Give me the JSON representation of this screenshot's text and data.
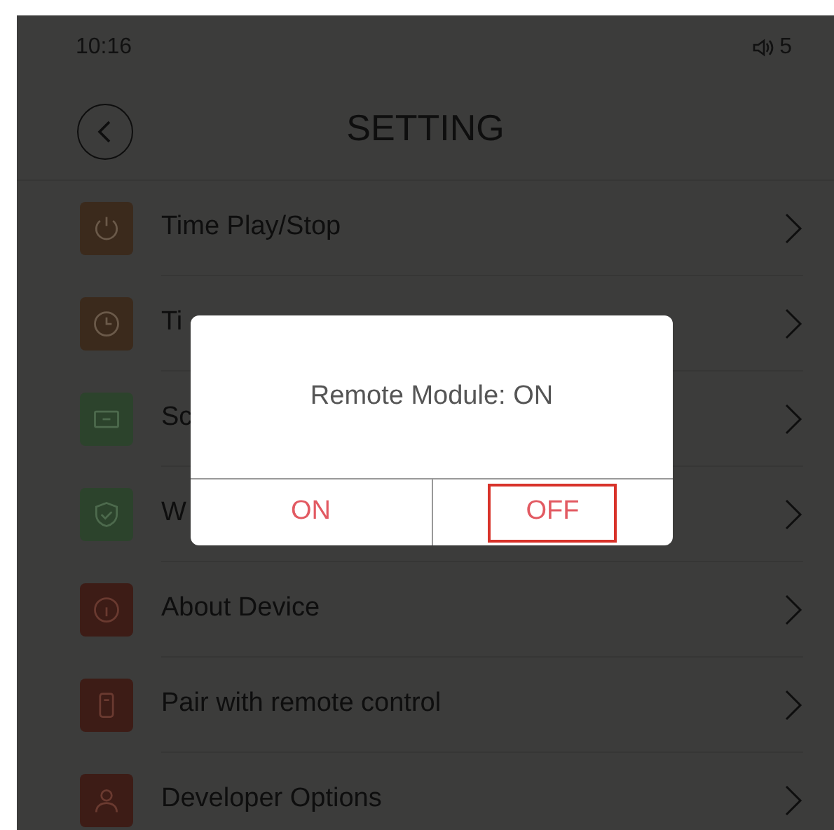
{
  "status_bar": {
    "time": "10:16",
    "volume": "5"
  },
  "header": {
    "title": "SETTING"
  },
  "items": [
    {
      "label": "Time Play/Stop",
      "color": "#3b2a1c"
    },
    {
      "label": "Ti",
      "color": "#3b2a1c"
    },
    {
      "label": "Sc",
      "color": "#2c432c"
    },
    {
      "label": "W",
      "color": "#2c432c"
    },
    {
      "label": "About Device",
      "color": "#3d1c16"
    },
    {
      "label": "Pair with remote control",
      "color": "#3d1c16"
    },
    {
      "label": "Developer Options",
      "color": "#3d1c16"
    }
  ],
  "dialog": {
    "message": "Remote Module: ON",
    "buttons": [
      {
        "label": "ON",
        "selected": false
      },
      {
        "label": "OFF",
        "selected": true
      }
    ]
  }
}
